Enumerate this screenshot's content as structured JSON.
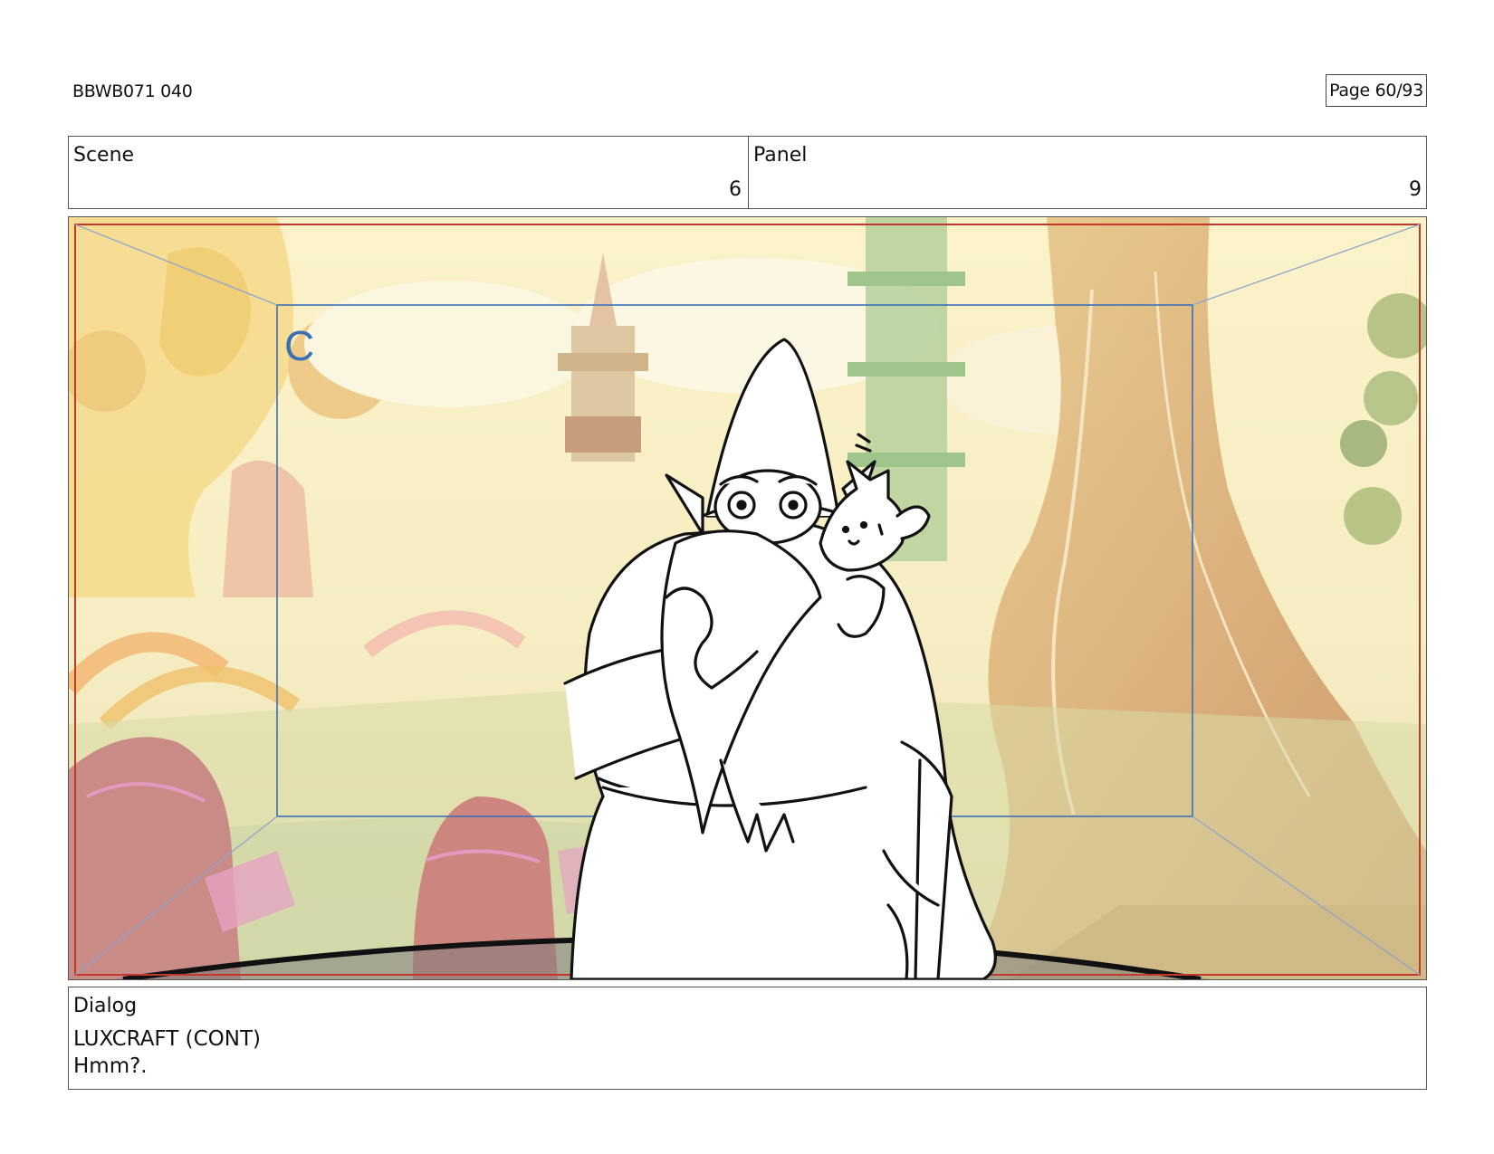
{
  "header": {
    "doc_id": "BBWB071 040",
    "page": "Page 60/93"
  },
  "info": {
    "scene_label": "Scene",
    "scene_value": "6",
    "panel_label": "Panel",
    "panel_value": "9"
  },
  "frame": {
    "camera_field_label": "C"
  },
  "dialog": {
    "label": "Dialog",
    "speaker": "LUXCRAFT (CONT)",
    "line": "Hmm?."
  },
  "colors": {
    "safe_frame": "#c0392b",
    "camera_field": "#3b6fb6",
    "sketch_line": "#111111"
  }
}
